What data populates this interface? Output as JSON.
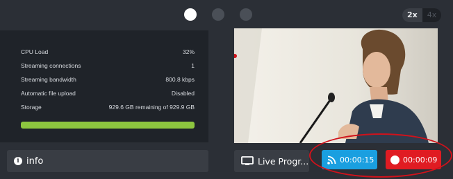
{
  "topbar": {
    "page_dots": [
      {
        "active": true
      },
      {
        "active": false
      },
      {
        "active": false
      }
    ],
    "zoom": {
      "options": [
        "2x",
        "4x"
      ],
      "selected": "2x"
    }
  },
  "stats": {
    "rows": [
      {
        "key": "CPU Load",
        "value": "32%"
      },
      {
        "key": "Streaming connections",
        "value": "1"
      },
      {
        "key": "Streaming bandwidth",
        "value": "800.8 kbps"
      },
      {
        "key": "Automatic file upload",
        "value": "Disabled"
      },
      {
        "key": "Storage",
        "value": "929.6 GB remaining of 929.9 GB"
      }
    ],
    "storage_bar": {
      "fraction_filled": 1.0,
      "color": "#8dc63f"
    }
  },
  "info_button": {
    "label": "info",
    "icon": "info-circle-icon"
  },
  "live_button": {
    "label": "Live Progr...",
    "icon": "monitor-icon"
  },
  "stream_button": {
    "label": "00:00:15",
    "icon": "rss-icon",
    "color": "#1a9fe0"
  },
  "record_button": {
    "label": "00:00:09",
    "icon": "record-dot-icon",
    "color": "#e01b22"
  },
  "colors": {
    "background": "#2b2f36",
    "panel": "#1f2329",
    "button": "#393d44",
    "highlight_circle": "#d0121b"
  }
}
